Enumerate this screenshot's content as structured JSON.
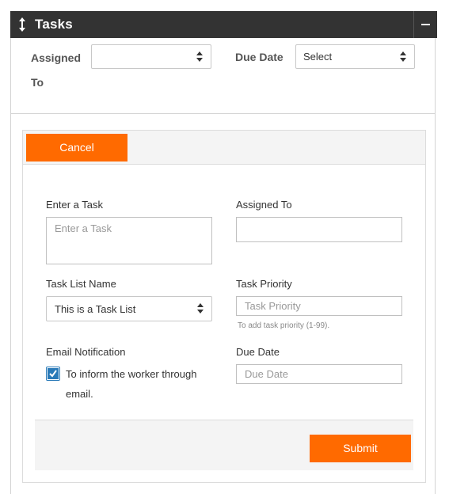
{
  "panel": {
    "title": "Tasks",
    "drag_icon": "vertical-arrows-icon",
    "collapse_icon": "minus-icon"
  },
  "filters": {
    "assigned_line1": "Assigned",
    "assigned_line2": "To",
    "assigned_value": "",
    "due_label": "Due Date",
    "due_value": "Select"
  },
  "form": {
    "cancel_label": "Cancel",
    "task_label": "Enter a Task",
    "task_placeholder": "Enter a Task",
    "assigned_label": "Assigned To",
    "assigned_value": "",
    "list_label": "Task List Name",
    "list_value": "This is a Task List",
    "priority_label": "Task Priority",
    "priority_placeholder": "Task Priority",
    "priority_help": "To add task priority (1-99).",
    "email_label": "Email Notification",
    "email_checked": true,
    "email_text_line1": "To inform the worker through",
    "email_text_line2": "email.",
    "due_label": "Due Date",
    "due_placeholder": "Due Date",
    "submit_label": "Submit"
  },
  "colors": {
    "header_bg": "#333333",
    "accent": "#ff6a00",
    "checkbox": "#2a7ab8"
  }
}
